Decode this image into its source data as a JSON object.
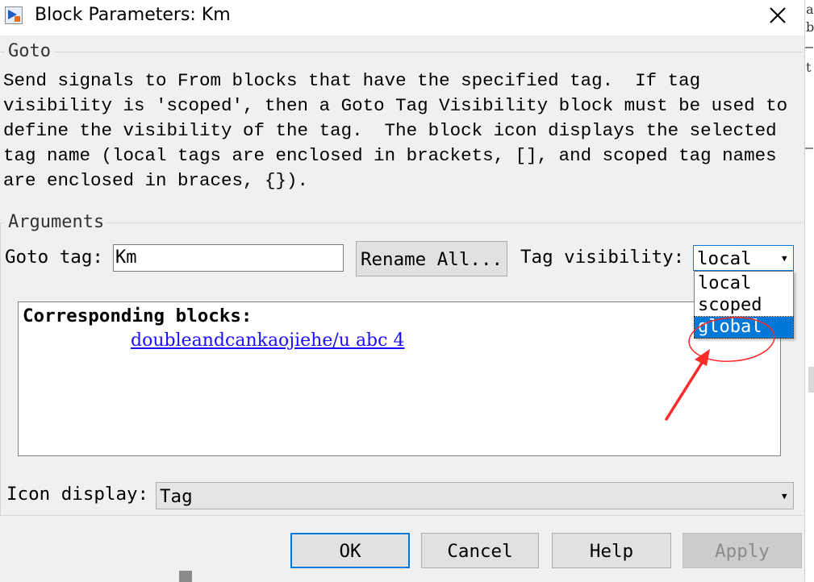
{
  "window": {
    "title": "Block Parameters: Km",
    "close_glyph": "✕"
  },
  "goto_section": {
    "title": "Goto",
    "description": "Send signals to From blocks that have the specified tag.  If tag\nvisibility is 'scoped', then a Goto Tag Visibility block must be used to\ndefine the visibility of the tag.  The block icon displays the selected\ntag name (local tags are enclosed in brackets, [], and scoped tag names\nare enclosed in braces, {})."
  },
  "arguments": {
    "title": "Arguments",
    "goto_tag_label": "Goto tag:",
    "goto_tag_value": "Km",
    "rename_button": "Rename All...",
    "visibility_label": "Tag visibility:",
    "visibility_value": "local",
    "visibility_options": [
      "local",
      "scoped",
      "global"
    ],
    "highlighted_option": "global",
    "corresponding_title": "Corresponding blocks:",
    "corresponding_link": "doubleandcankaojiehe/u abc 4",
    "icon_display_label": "Icon display:",
    "icon_display_value": "Tag"
  },
  "buttons": {
    "ok": "OK",
    "cancel": "Cancel",
    "help": "Help",
    "apply": "Apply"
  },
  "background_window": {
    "fragments": [
      "a",
      "b",
      "t"
    ]
  },
  "colors": {
    "selection": "#0078d7",
    "link": "#1a0dff",
    "annotation": "#ff2a2a"
  }
}
